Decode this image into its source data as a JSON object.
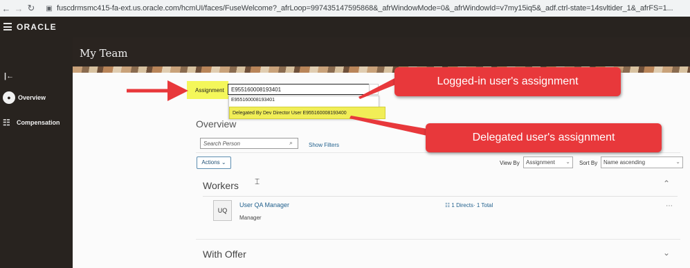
{
  "browser": {
    "back_icon": "←",
    "forward_icon": "→",
    "reload_icon": "↻",
    "lock_icon": "🔒",
    "url": "fuscdrmsmc415-fa-ext.us.oracle.com/hcmUI/faces/FuseWelcome?_afrLoop=997435147595868&_afrWindowMode=0&_afrWindowId=v7my15iq5&_adf.ctrl-state=14svltider_1&_afrFS=1..."
  },
  "header": {
    "logo": "ORACLE"
  },
  "sidebar": {
    "collapse_icon": "|←",
    "items": [
      {
        "label": "Overview",
        "icon": "people-icon"
      },
      {
        "label": "Compensation",
        "icon": "compensation-icon"
      }
    ]
  },
  "page": {
    "title": "My Team"
  },
  "assignment": {
    "label": "Assignment",
    "value": "E955160008193401",
    "caret": "⌄",
    "options": [
      "E955160008193401",
      "Delegated By Dev Director User E955160008193400"
    ]
  },
  "overview": {
    "heading": "Overview",
    "search_placeholder": "Search Person",
    "show_filters": "Show Filters",
    "actions_label": "Actions ⌄",
    "view_by_label": "View By",
    "view_by_value": "Assignment",
    "sort_by_label": "Sort By",
    "sort_by_value": "Name ascending",
    "select_caret": "⌄"
  },
  "workers": {
    "title": "Workers",
    "expand_chevron": "⌃",
    "rows": [
      {
        "initials": "UQ",
        "name": "User QA Manager",
        "job": "Manager",
        "directs": "1 Directs· 1 Total"
      }
    ],
    "more": "⋯"
  },
  "with_offer": {
    "title": "With Offer",
    "chevron": "⌄"
  },
  "annotations": {
    "logged_in": "Logged-in user's assignment",
    "delegated": "Delegated user's assignment"
  },
  "colors": {
    "highlight": "#f4f75a",
    "callout": "#e8383b",
    "link": "#1f5f8c",
    "dark_bg": "#28231f"
  }
}
